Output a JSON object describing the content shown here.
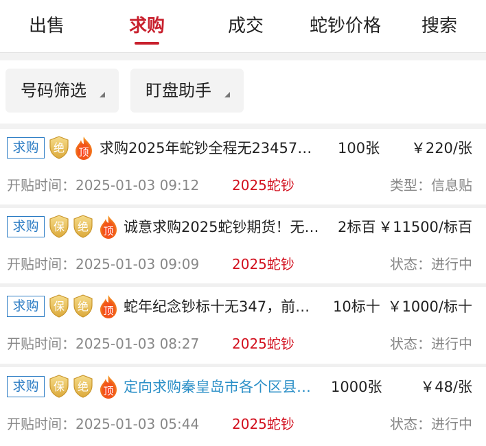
{
  "tabs": [
    {
      "label": "出售"
    },
    {
      "label": "求购"
    },
    {
      "label": "成交"
    },
    {
      "label": "蛇钞价格"
    },
    {
      "label": "搜索"
    }
  ],
  "filters": {
    "number_filter": "号码筛选",
    "watch_assistant": "盯盘助手"
  },
  "colors": {
    "accent": "#c8202d",
    "badge_blue": "#2b7cc4",
    "shield_gold": "#e8c060",
    "fire_orange": "#f07020",
    "tag_red": "#d2101e",
    "link_blue": "#2b8fc7"
  },
  "icons": {
    "jue": "绝",
    "bao": "保",
    "ding": "顶"
  },
  "listings": [
    {
      "badge": "求购",
      "title": "求购2025年蛇钞全程无23457号…",
      "qty": "100张",
      "price": "￥220/张",
      "time": "开贴时间：2025-01-03 09:12",
      "tag": "2025蛇钞",
      "status": "类型：信息贴"
    },
    {
      "badge": "求购",
      "title": "诚意求购2025蛇钞期货！无…",
      "qty": "2标百",
      "price": "￥11500/标百",
      "time": "开贴时间：2025-01-03 09:09",
      "tag": "2025蛇钞",
      "status": "状态：进行中"
    },
    {
      "badge": "求购",
      "title": "蛇年纪念钞标十无347，前…",
      "qty": "10标十",
      "price": "￥1000/标十",
      "time": "开贴时间：2025-01-03 08:27",
      "tag": "2025蛇钞",
      "status": "状态：进行中"
    },
    {
      "badge": "求购",
      "title": "定向求购秦皇岛市各个区县…",
      "qty": "1000张",
      "price": "￥48/张",
      "time": "开贴时间：2025-01-03 05:44",
      "tag": "2025蛇钞",
      "status": "状态：进行中"
    }
  ]
}
